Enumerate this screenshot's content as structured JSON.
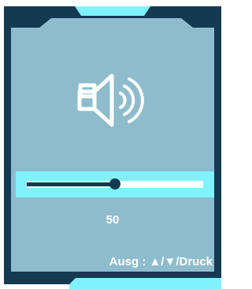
{
  "colors": {
    "frame": "#143a52",
    "panel": "#8ebccc",
    "accent": "#7ff2fb",
    "text": "#ffffff"
  },
  "volume": {
    "icon": "speaker-icon",
    "value_label": "50",
    "level_fraction": 0.5
  },
  "footer": {
    "hint": "Ausg : ▲/▼/Druck"
  }
}
